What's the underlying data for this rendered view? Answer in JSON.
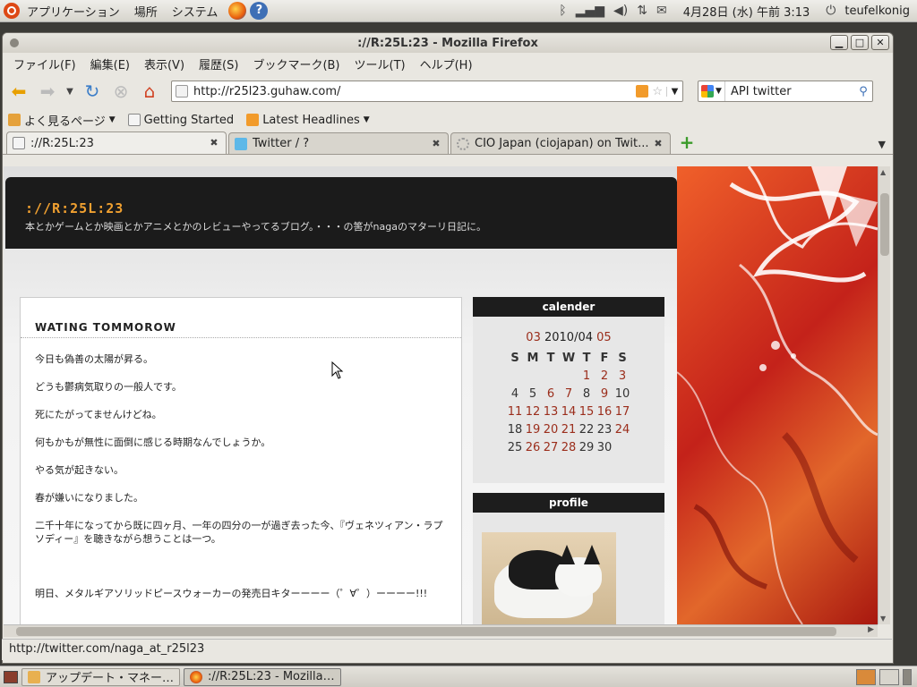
{
  "top_panel": {
    "menus": [
      "アプリケーション",
      "場所",
      "システム"
    ],
    "datetime": "4月28日 (水) 午前 3:13",
    "user": "teufelkonig"
  },
  "window": {
    "title": "://R:25L:23 - Mozilla Firefox"
  },
  "menubar": {
    "items": [
      "ファイル(F)",
      "編集(E)",
      "表示(V)",
      "履歴(S)",
      "ブックマーク(B)",
      "ツール(T)",
      "ヘルプ(H)"
    ]
  },
  "navbar": {
    "url": "http://r25l23.guhaw.com/",
    "search_value": "API twitter"
  },
  "bookmarks": {
    "items": [
      "よく見るページ",
      "Getting Started",
      "Latest Headlines"
    ]
  },
  "tabs": [
    {
      "label": "://R:25L:23",
      "active": true
    },
    {
      "label": "Twitter / ?",
      "active": false
    },
    {
      "label": "CIO Japan (ciojapan) on Twit...",
      "active": false
    }
  ],
  "blog": {
    "title": "://R:25L:23",
    "description": "本とかゲームとか映画とかアニメとかのレビューやってるブログ。・・・の筈がnagaのマターリ日記に。"
  },
  "post": {
    "title": "WATING TOMMOROW",
    "lines": [
      "今日も偽善の太陽が昇る。",
      "どうも鬱病気取りの一般人です。",
      "死にたがってませんけどね。",
      "何もかもが無性に面倒に感じる時期なんでしょうか。",
      "やる気が起きない。",
      "春が嫌いになりました。",
      "二千十年になってから既に四ヶ月、一年の四分の一が過ぎ去った今、『ヴェネツィアン・ラプソディー』を聴きながら想うことは一つ。",
      "明日、メタルギアソリッドピースウォーカーの発売日キターーーー（゜∀゜）ーーーー!!!"
    ]
  },
  "calendar": {
    "heading": "calender",
    "prev": "03",
    "current": "2010/04",
    "next": "05",
    "weekdays": [
      "S",
      "M",
      "T",
      "W",
      "T",
      "F",
      "S"
    ],
    "weeks": [
      [
        "",
        "",
        "",
        "",
        "1",
        "2",
        "3"
      ],
      [
        "4",
        "5",
        "6",
        "7",
        "8",
        "9",
        "10"
      ],
      [
        "11",
        "12",
        "13",
        "14",
        "15",
        "16",
        "17"
      ],
      [
        "18",
        "19",
        "20",
        "21",
        "22",
        "23",
        "24"
      ],
      [
        "25",
        "26",
        "27",
        "28",
        "29",
        "30",
        ""
      ]
    ],
    "linked_days": [
      "1",
      "2",
      "3",
      "6",
      "7",
      "9",
      "11",
      "12",
      "13",
      "14",
      "15",
      "16",
      "17",
      "19",
      "20",
      "21",
      "24",
      "26",
      "27",
      "28"
    ]
  },
  "profile": {
    "heading": "profile"
  },
  "statusbar": {
    "text": "http://twitter.com/naga_at_r25l23"
  },
  "taskbar": {
    "items": [
      {
        "label": "アップデート・マネー…",
        "active": false
      },
      {
        "label": "://R:25L:23 - Mozilla…",
        "active": true
      }
    ]
  },
  "colors": {
    "blog_title": "#f0a030",
    "calendar_link": "#9b2d1b",
    "header_bg": "#1b1b1b"
  }
}
